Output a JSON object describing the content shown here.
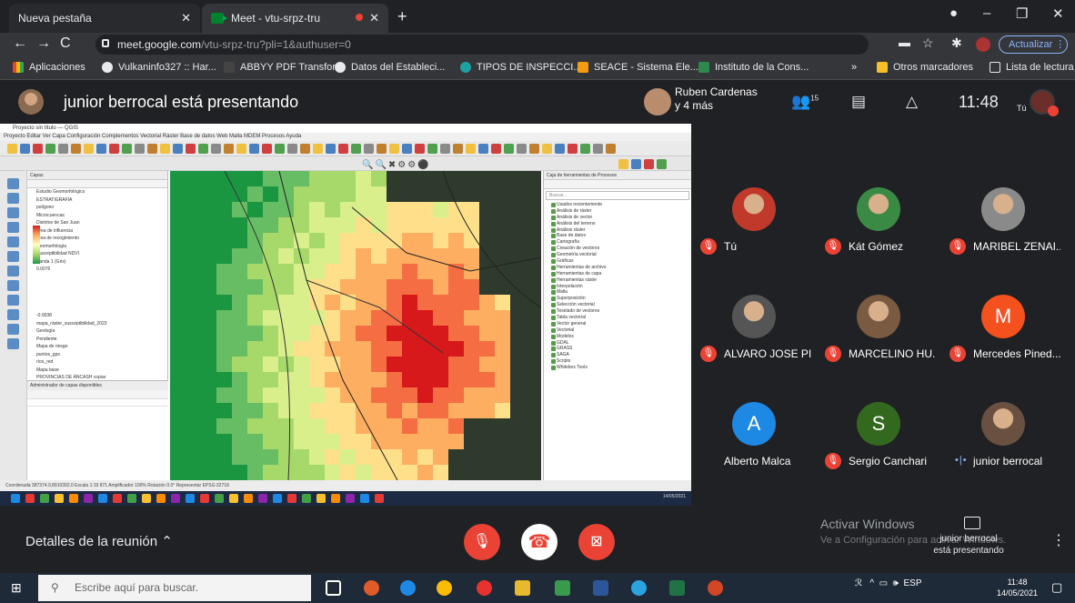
{
  "browser": {
    "tabs": [
      {
        "title": "Nueva pestaña"
      },
      {
        "title": "Meet - vtu-srpz-tru"
      }
    ],
    "url_host": "meet.google.com",
    "url_path": "/vtu-srpz-tru?pli=1&authuser=0",
    "update_label": "Actualizar",
    "bookmarks": [
      "Aplicaciones",
      "Vulkaninfo327 :: Har...",
      "ABBYY PDF Transfor...",
      "Datos del Estableci...",
      "TIPOS DE INSPECCI...",
      "SEACE - Sistema Ele...",
      "Instituto de la Cons..."
    ],
    "more_bookmarks": "»",
    "other_bookmarks": "Otros marcadores",
    "reading_list": "Lista de lectura"
  },
  "meet": {
    "presenting_text": "junior berrocal está presentando",
    "chip_name": "Ruben Cardenas",
    "chip_more": "y 4 más",
    "people_count": "15",
    "clock": "11:48",
    "self_label": "Tú",
    "participants": [
      {
        "name": "Tú",
        "muted": true,
        "avatar": "photo",
        "color": "#c0392b"
      },
      {
        "name": "Kát Gómez",
        "muted": true,
        "avatar": "photo",
        "color": "#3a8a45"
      },
      {
        "name": "MARIBEL ZENAI...",
        "muted": true,
        "avatar": "photo",
        "color": "#8a8a8a"
      },
      {
        "name": "ALVARO JOSE PI...",
        "muted": true,
        "avatar": "photo",
        "color": "#555555"
      },
      {
        "name": "MARCELINO HU...",
        "muted": true,
        "avatar": "photo",
        "color": "#7a5a40"
      },
      {
        "name": "Mercedes Pined...",
        "muted": true,
        "avatar": "letter",
        "letter": "M",
        "color": "#f4511e"
      },
      {
        "name": "Alberto Malca",
        "muted": false,
        "avatar": "letter",
        "letter": "A",
        "color": "#1e88e5"
      },
      {
        "name": "Sergio Canchari",
        "muted": true,
        "avatar": "letter",
        "letter": "S",
        "color": "#33691e"
      },
      {
        "name": "junior berrocal",
        "muted": false,
        "speaking": true,
        "avatar": "photo",
        "color": "#6a5040"
      }
    ],
    "details_label": "Detalles de la reunión",
    "presenting_note_line1": "junior berrocal",
    "presenting_note_line2": "está presentando",
    "activate_windows": "Activar Windows",
    "activate_windows_sub": "Ve a Configuración para activar Windows."
  },
  "qgis": {
    "title": "Proyecto sin título — QGIS",
    "menu": "Proyecto  Editar  Ver  Capa  Configuración  Complementos  Vectorial  Ráster  Base de datos  Web  Malla  MDEM  Procesos  Ayuda",
    "layers_title": "Capas",
    "layers": [
      "Estudio Geomorfológico",
      "ESTRATIGRAFÍA",
      "polígono",
      "Microcuencas",
      "Distritos de San Juan",
      "Área de influencia",
      "área de recogimiento",
      "Geomorfología",
      "Susceptibilidad NDVI",
      "Banda 1 (Gris)",
      "0.0076",
      "",
      "",
      "",
      "",
      "",
      "-0.0038",
      "mapa_ráster_susceptibilidad_2023",
      "Geología",
      "Pendiente",
      "Mapa de riesgo",
      "puntos_gps",
      "ríos_red",
      "Mapa base",
      "PROVINCIAS DE ÁNCASH copiar"
    ],
    "browser_title": "Administrador de capas disponibles",
    "toolbox_title": "Caja de herramientas de Procesos",
    "toolbox_search": "Buscar...",
    "tools": [
      "Usados recientemente",
      "Análisis de ráster",
      "Análisis de vector",
      "Análisis del terreno",
      "Análisis ráster",
      "Base de datos",
      "Cartografía",
      "Creación de vectores",
      "Geometría vectorial",
      "Gráficas",
      "Herramientas de archivo",
      "Herramientas de capa",
      "Herramientas ráster",
      "Interpolación",
      "Malla",
      "Superposición",
      "Selección vectorial",
      "Teselado de vectores",
      "Tabla vectorial",
      "Vector general",
      "Vectorial",
      "Modelos",
      "GDAL",
      "GRASS",
      "SAGA",
      "Scripts",
      "Whitebox Tools"
    ],
    "status": "Coordenada  387374.9,8910392.0    Escala 1:19 871    Amplificador 100%    Rotación 0.0°    Representar    EPSG:32718",
    "date": "14/05/2021"
  },
  "taskbar": {
    "search_placeholder": "Escribe aquí para buscar.",
    "language": "ESP",
    "time": "11:48",
    "date": "14/05/2021"
  }
}
